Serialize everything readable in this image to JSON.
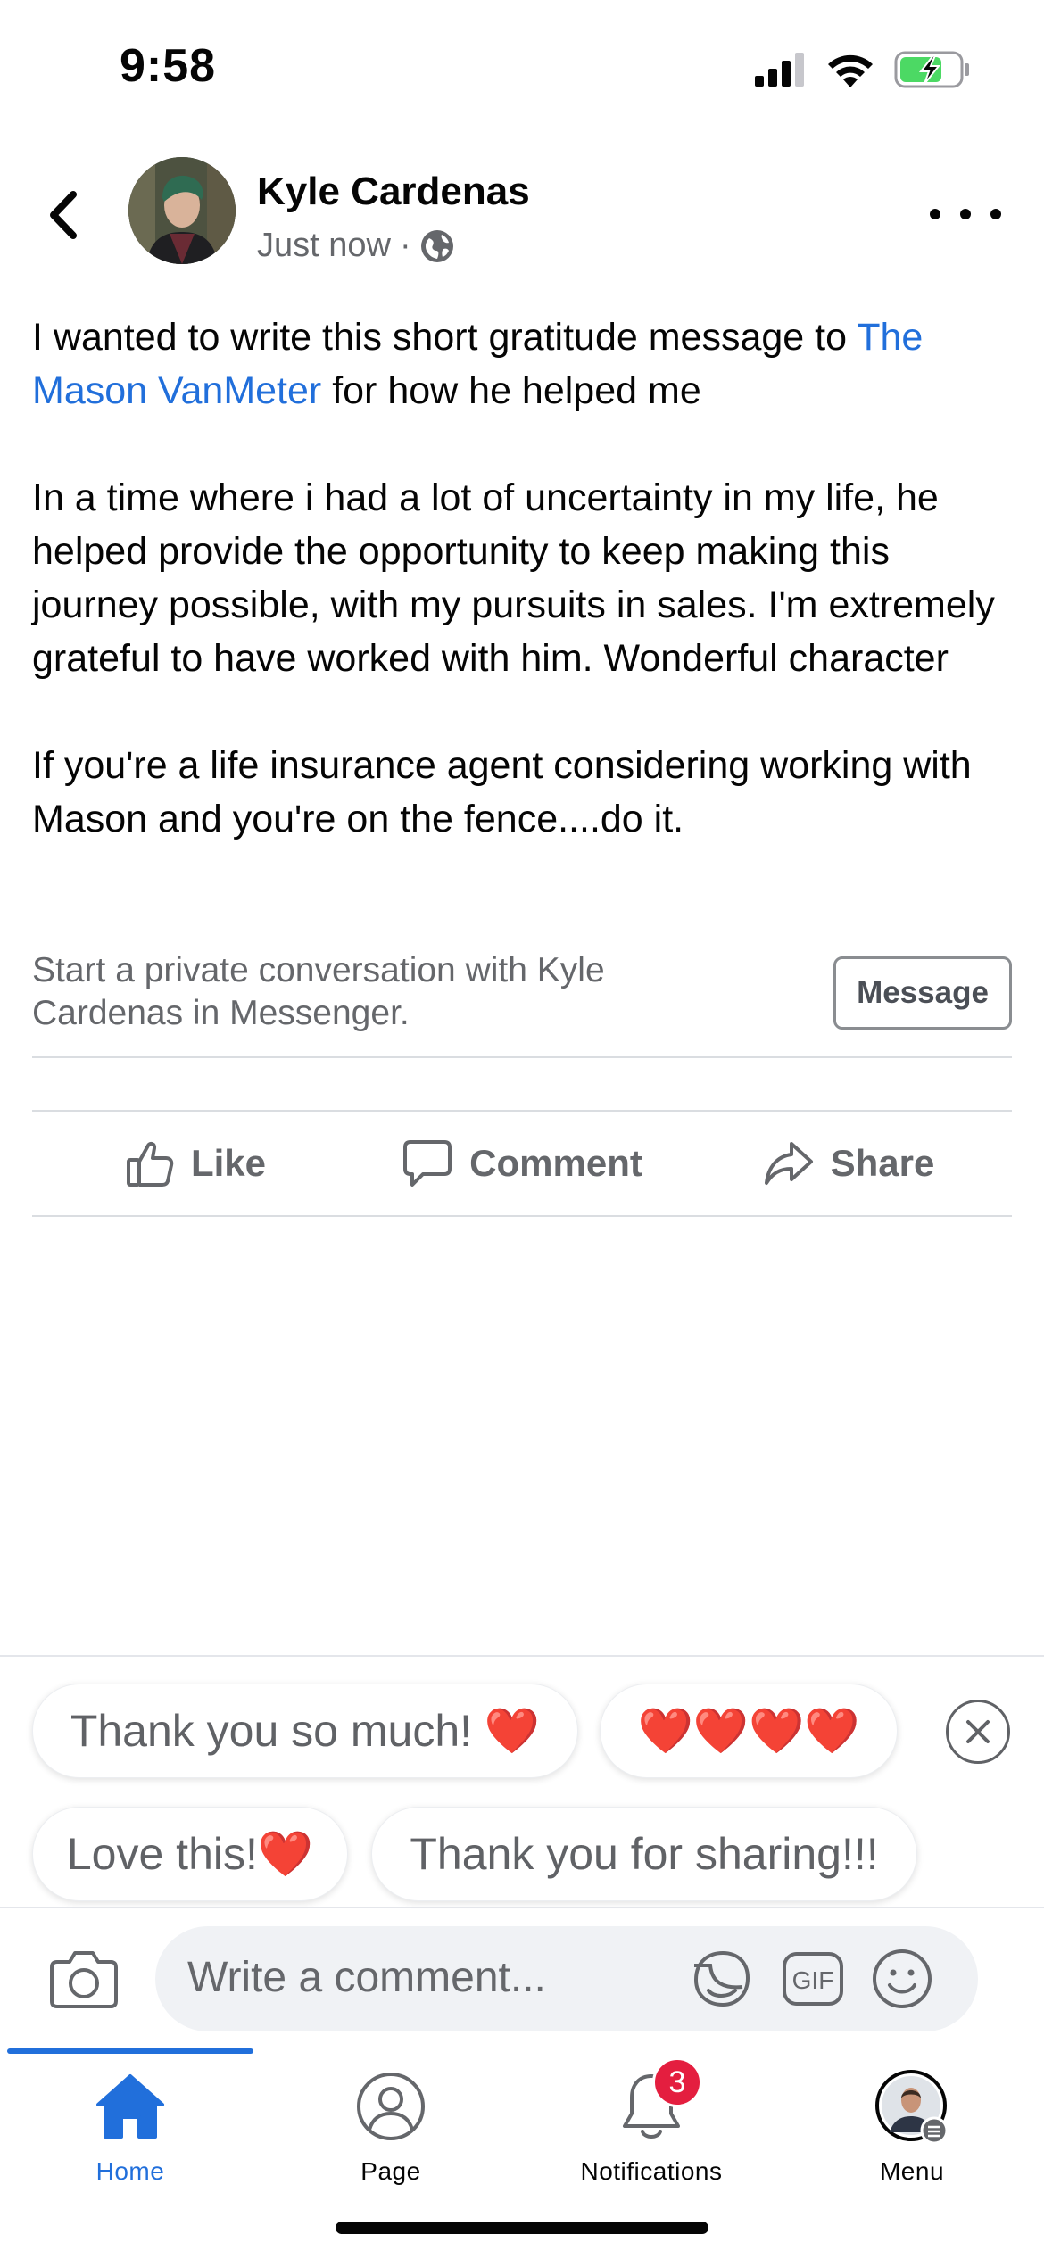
{
  "status_bar": {
    "time": "9:58",
    "icons": [
      "signal-icon",
      "wifi-icon",
      "battery-charging-icon"
    ]
  },
  "post": {
    "author": "Kyle Cardenas",
    "timestamp": "Just now",
    "separator": "·",
    "audience_icon": "globe-icon",
    "body": {
      "p1_pre": "I wanted to write this short gratitude message to ",
      "p1_mention": "The Mason VanMeter",
      "p1_post": " for how he helped me",
      "p2": "In a time where i had a lot of uncertainty in my life, he helped provide the opportunity to keep making this journey possible, with my pursuits in sales. I'm extremely grateful to have worked with him. Wonderful character",
      "p3": "If you're a life insurance agent considering working with Mason and you're on the fence....do it."
    }
  },
  "messenger_prompt": {
    "text": "Start a private conversation with Kyle Cardenas in Messenger.",
    "button_label": "Message"
  },
  "actions": {
    "like": "Like",
    "comment": "Comment",
    "share": "Share"
  },
  "quick_replies": [
    "Thank you so much! ❤️",
    "❤️❤️❤️❤️",
    "Love this!❤️",
    "Thank you for sharing!!!"
  ],
  "composer": {
    "placeholder": "Write a comment...",
    "gif_label": "GIF"
  },
  "tabs": [
    {
      "label": "Home",
      "icon": "home-icon",
      "active": true
    },
    {
      "label": "Page",
      "icon": "page-profile-icon",
      "active": false
    },
    {
      "label": "Notifications",
      "icon": "bell-icon",
      "active": false,
      "badge": "3"
    },
    {
      "label": "Menu",
      "icon": "menu-avatar-icon",
      "active": false
    }
  ],
  "colors": {
    "accent": "#216fdb",
    "text": "#050505",
    "secondary_text": "#65676b",
    "badge": "#e41e3f",
    "battery": "#4cd964"
  }
}
